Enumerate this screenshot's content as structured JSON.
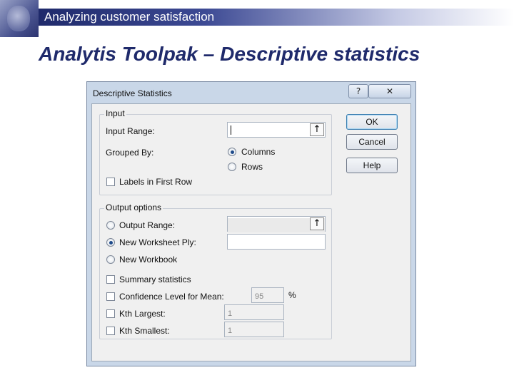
{
  "banner": {
    "title": "Analyzing customer satisfaction"
  },
  "slide": {
    "title": "Analytis Toolpak – Descriptive statistics"
  },
  "dialog": {
    "title": "Descriptive Statistics",
    "help_glyph": "?",
    "close_glyph": "✕",
    "input_group": {
      "legend": "Input",
      "input_range_label": "Input Range:",
      "input_range_value": "",
      "grouped_by_label": "Grouped By:",
      "columns_label": "Columns",
      "rows_label": "Rows",
      "grouped_by_selected": "Columns",
      "labels_first_row_label": "Labels in First Row",
      "labels_first_row_checked": false
    },
    "output_group": {
      "legend": "Output options",
      "output_range_label": "Output Range:",
      "output_range_value": "",
      "new_ply_label": "New Worksheet Ply:",
      "new_ply_value": "",
      "new_workbook_label": "New Workbook",
      "selected": "New Worksheet Ply",
      "summary_label": "Summary statistics",
      "confidence_label": "Confidence Level for Mean:",
      "confidence_value": "95",
      "percent_sign": "%",
      "kth_largest_label": "Kth Largest:",
      "kth_largest_value": "1",
      "kth_smallest_label": "Kth Smallest:",
      "kth_smallest_value": "1"
    },
    "buttons": {
      "ok": "OK",
      "cancel": "Cancel",
      "help": "Help"
    },
    "ref_button_glyph": "↑"
  }
}
